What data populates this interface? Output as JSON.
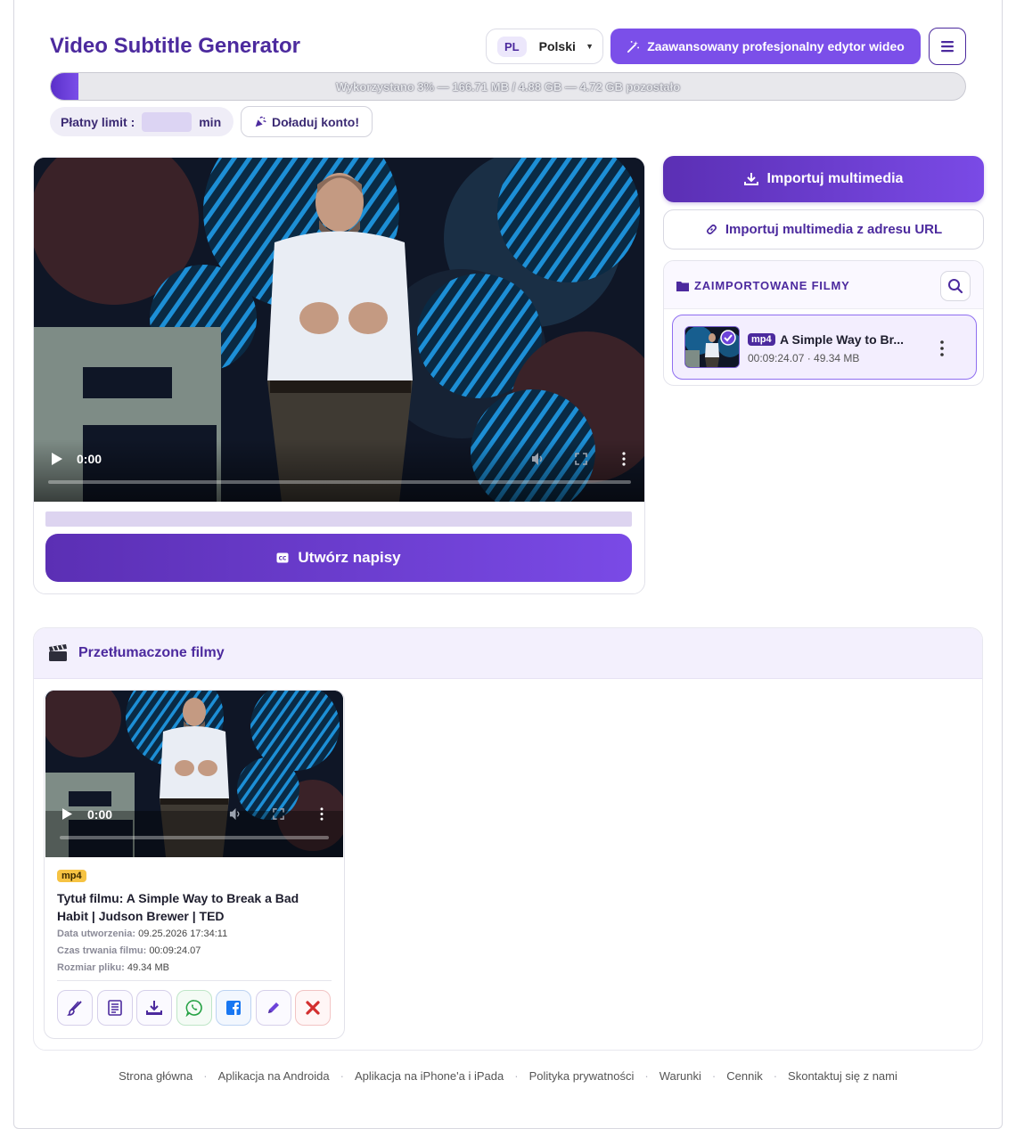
{
  "app": {
    "title": "Video Subtitle Generator"
  },
  "header": {
    "language": {
      "code": "PL",
      "name": "Polski"
    },
    "pro_editor_label": "Zaawansowany profesjonalny edytor wideo",
    "menu_icon": "hamburger-icon"
  },
  "usage": {
    "percent": 3,
    "text": "Wykorzystano 3% — 166.71 MB / 4.88 GB — 4.72 GB pozostało"
  },
  "limit": {
    "label": "Płatny limit :",
    "value": "",
    "unit": "min",
    "recharge_label": "Doładuj konto!"
  },
  "player": {
    "time": "0:00",
    "create_button": "Utwórz napisy"
  },
  "import": {
    "button": "Importuj multimedia",
    "url_button": "Importuj multimedia z adresu URL",
    "panel_title": "ZAIMPORTOWANE FILMY",
    "files": [
      {
        "format": "mp4",
        "name": "A Simple Way to Br...",
        "duration": "00:09:24.07",
        "size": "49.34 MB",
        "meta": "00:09:24.07 · 49.34 MB"
      }
    ]
  },
  "translated": {
    "title": "Przetłumaczone filmy",
    "videos": [
      {
        "time": "0:00",
        "format": "mp4",
        "title": "Tytuł filmu: A Simple Way to Break a Bad Habit | Judson Brewer | TED",
        "created_label": "Data utworzenia:",
        "created": "09.25.2026 17:34:11",
        "duration_label": "Czas trwania filmu:",
        "duration": "00:09:24.07",
        "size_label": "Rozmiar pliku:",
        "size": "49.34 MB",
        "actions": [
          "brush-icon",
          "document-icon",
          "download-icon",
          "whatsapp-icon",
          "facebook-icon",
          "pencil-icon",
          "close-icon"
        ]
      }
    ]
  },
  "footer": {
    "links": [
      "Strona główna",
      "Aplikacja na Androida",
      "Aplikacja na iPhone'a i iPada",
      "Polityka prywatności",
      "Warunki",
      "Cennik",
      "Skontaktuj się z nami"
    ]
  },
  "colors": {
    "brand": "#4c2a9e",
    "accent": "#7b4fe9",
    "badge_yellow": "#f6c343"
  }
}
